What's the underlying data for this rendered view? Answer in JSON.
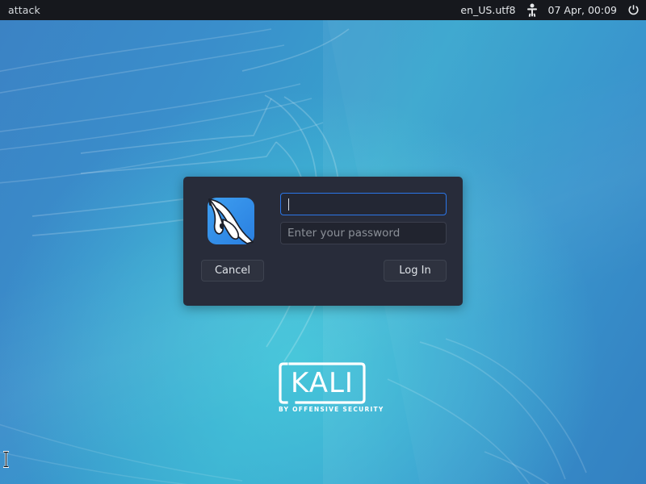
{
  "topbar": {
    "hostname": "attack",
    "menu_icon": "hamburger-menu-icon",
    "keyboard_layout": "en_US.utf8",
    "accessibility_icon": "accessibility-person-icon",
    "datetime": "07 Apr, 00:09",
    "power_icon": "power-icon",
    "background_color": "#16181d",
    "text_color": "#e4e7ea"
  },
  "login": {
    "app_icon": "kali-dragon-icon",
    "username": {
      "value": "",
      "placeholder": "",
      "focused": true
    },
    "password": {
      "value": "",
      "placeholder": "Enter your password"
    },
    "cancel_label": "Cancel",
    "login_label": "Log In",
    "dialog_color": "#282c3a",
    "focus_color": "#2b76e8"
  },
  "branding": {
    "wordmark": "KALI",
    "tagline": "BY OFFENSIVE SECURITY",
    "color": "#ffffff"
  },
  "desktop": {
    "wallpaper_accent": "#37a6ce",
    "wallpaper_base": "#3b82c4",
    "cursor": "text-ibeam-cursor"
  }
}
